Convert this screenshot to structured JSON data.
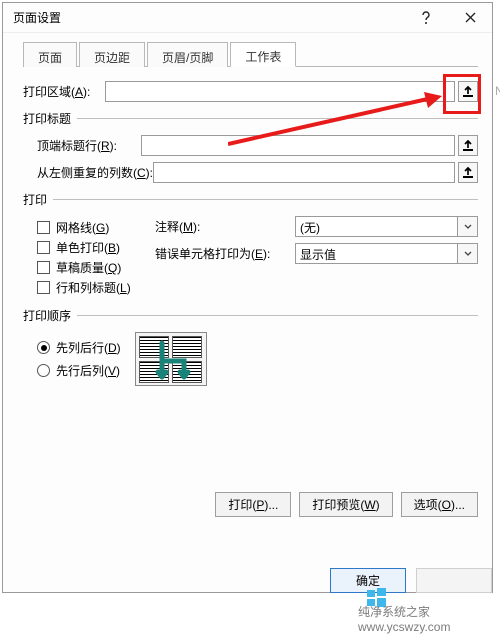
{
  "title": "页面设置",
  "tabs": {
    "page": "页面",
    "margin": "页边距",
    "headerfooter": "页眉/页脚",
    "sheet": "工作表"
  },
  "print_area": {
    "label_pre": "打印区域(",
    "key": "A",
    "label_post": "):"
  },
  "titles": {
    "heading": "打印标题",
    "top": {
      "pre": "顶端标题行(",
      "key": "R",
      "post": "):"
    },
    "left": {
      "pre": "从左侧重复的列数(",
      "key": "C",
      "post": "):"
    }
  },
  "print_opts": {
    "heading": "打印",
    "grid": {
      "pre": "网格线(",
      "key": "G",
      "post": ")"
    },
    "bw": {
      "pre": "单色打印(",
      "key": "B",
      "post": ")"
    },
    "draft": {
      "pre": "草稿质量(",
      "key": "Q",
      "post": ")"
    },
    "rowcol": {
      "pre": "行和列标题(",
      "key": "L",
      "post": ")"
    },
    "comments": {
      "pre": "注释(",
      "key": "M",
      "post": "):",
      "value": "(无)"
    },
    "errors": {
      "pre": "错误单元格打印为(",
      "key": "E",
      "post": "):",
      "value": "显示值"
    }
  },
  "order": {
    "heading": "打印顺序",
    "downover": {
      "pre": "先列后行(",
      "key": "D",
      "post": ")"
    },
    "overdown": {
      "pre": "先行后列(",
      "key": "V",
      "post": ")"
    }
  },
  "buttons": {
    "print": {
      "pre": "打印(",
      "key": "P",
      "post": ")..."
    },
    "preview": {
      "pre": "打印预览(",
      "key": "W",
      "post": ")"
    },
    "options": {
      "pre": "选项(",
      "key": "O",
      "post": ")..."
    },
    "ok": "确定",
    "cancel": " "
  },
  "watermark": "纯净系统之家  www.ycswzy.com",
  "stray": "N"
}
